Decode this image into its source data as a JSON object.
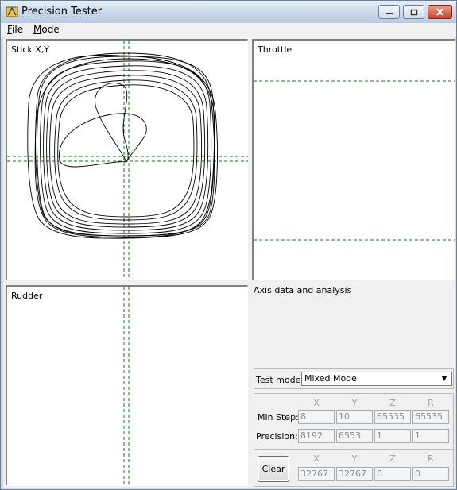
{
  "window": {
    "title": "Precision Tester"
  },
  "menu": [
    {
      "label": "File",
      "accel": "F",
      "rest": "ile"
    },
    {
      "label": "Mode",
      "accel": "M",
      "rest": "ode"
    }
  ],
  "panels": {
    "stick": {
      "label": "Stick X,Y"
    },
    "throttle": {
      "label": "Throttle"
    },
    "rudder": {
      "label": "Rudder"
    }
  },
  "analysis": {
    "title": "Axis data and analysis",
    "test_mode_label": "Test mode:",
    "test_mode_value": "Mixed Mode",
    "columns": [
      "X",
      "Y",
      "Z",
      "R"
    ],
    "min_step_label": "Min Step:",
    "min_step": [
      "8",
      "10",
      "65535",
      "65535"
    ],
    "precision_label": "Precision:",
    "precision": [
      "8192",
      "6553",
      "1",
      "1"
    ],
    "clear_label": "Clear",
    "current": [
      "32767",
      "32767",
      "0",
      "0"
    ]
  },
  "colors": {
    "guide": "#008000",
    "trace": "#000000"
  },
  "icons": {
    "app": "app-icon",
    "minimize": "minimize-icon",
    "maximize": "maximize-icon",
    "close": "close-icon",
    "dropdown": "chevron-down-icon"
  }
}
